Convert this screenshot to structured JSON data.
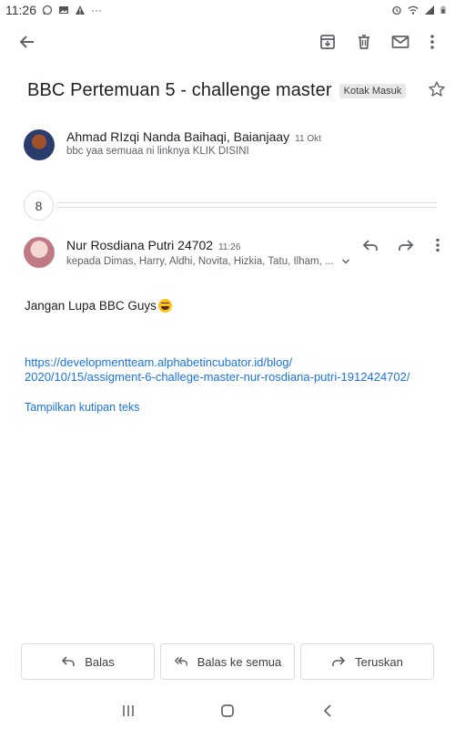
{
  "status_bar": {
    "time": "11:26",
    "overflow": "···"
  },
  "subject": {
    "title": "BBC Pertemuan 5 - challenge master",
    "label": "Kotak Masuk"
  },
  "messages": [
    {
      "sender": "Ahmad RIzqi Nanda Baihaqi, Baianjaay",
      "time": "11 Okt",
      "snippet": "bbc yaa semuaa ni linknya KLIK DISINI"
    },
    {
      "sender": "Nur Rosdiana Putri 24702",
      "time": "11:26",
      "recipients": "kepada Dimas, Harry, Aldhi, Novita, Hizkia, Tatu, Ilham, ...",
      "body": "Jangan Lupa BBC Guys",
      "link_line1": "https://developmentteam.alphabetincubator.id/blog/",
      "link_line2": "2020/10/15/assigment-6-challege-master-nur-rosdiana-putri-1912424702/",
      "show_quoted": "Tampilkan kutipan teks"
    }
  ],
  "collapsed_count": "8",
  "actions": {
    "reply": "Balas",
    "reply_all": "Balas ke semua",
    "forward": "Teruskan"
  },
  "icons": {
    "accent": "#1a73e8",
    "icon_color": "#5f6368"
  }
}
